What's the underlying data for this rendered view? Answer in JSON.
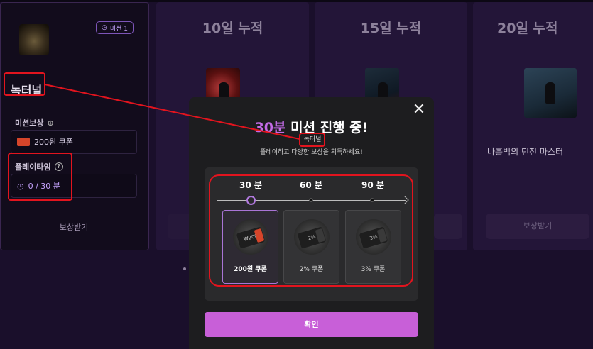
{
  "active_card": {
    "mission_badge": "미션 1",
    "game_name": "녹터널",
    "reward_label": "미션보상",
    "reward_value": "200원 쿠폰",
    "playtime_label": "플레이타임",
    "playtime_value": "0 / 30 분",
    "claim_button": "보상받기"
  },
  "cards": [
    {
      "title": "10일 누적"
    },
    {
      "title": "15일 누적"
    },
    {
      "title": "20일 누적",
      "caption": "나홀벅의 던전 마스터",
      "button": "보상받기"
    }
  ],
  "modal": {
    "title_accent": "30분",
    "title_rest": " 미션 진행 중!",
    "game_name": "녹터널",
    "subtitle": "플레이하고 다양한 보상을 획득하세요!",
    "close_symbol": "✕",
    "timeline": [
      "30 분",
      "60 분",
      "90 분"
    ],
    "rewards": [
      {
        "name": "200원 쿠폰",
        "art_text": "₩200",
        "selected": true
      },
      {
        "name": "2% 쿠폰",
        "art_text": "2%",
        "selected": false
      },
      {
        "name": "3% 쿠폰",
        "art_text": "3%",
        "selected": false
      }
    ],
    "confirm_button": "확인"
  },
  "colors": {
    "accent": "#c36be6",
    "confirm": "#c85fd8",
    "annotation": "#e2141e"
  }
}
